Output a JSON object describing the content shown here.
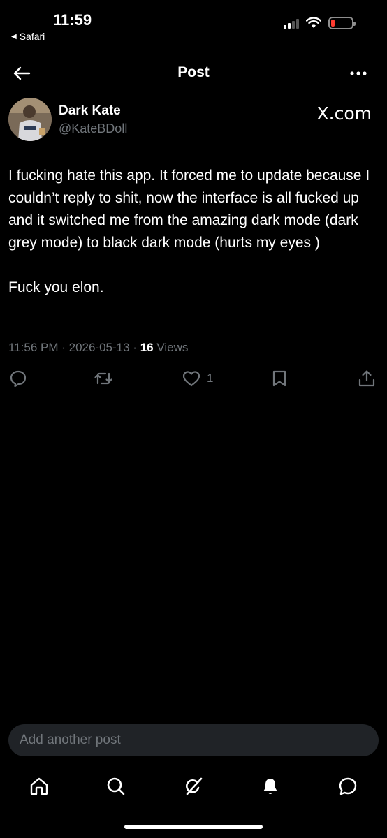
{
  "status_bar": {
    "time": "11:59",
    "back_app": "Safari",
    "battery_color": "#ff3b30"
  },
  "header": {
    "title": "Post",
    "back_icon": "arrow-left-icon",
    "more_icon": "more-horizontal-icon"
  },
  "post": {
    "author_name": "Dark Kate",
    "author_handle": "@KateBDoll",
    "brand": "X.com",
    "paragraphs": [
      "I fucking hate this app. It forced me to update because I couldn’t reply to shit, now the interface is all fucked up and it switched me from the amazing dark mode (dark grey mode) to black dark mode (hurts my eyes )",
      "Fuck you elon."
    ],
    "timestamp": "11:56 PM · 2026-05-13 · ",
    "views_count": "16",
    "views_label": " Views"
  },
  "actions": {
    "reply_icon": "reply-icon",
    "repost_icon": "repost-icon",
    "like_icon": "heart-icon",
    "like_count": "1",
    "bookmark_icon": "bookmark-icon",
    "share_icon": "share-icon"
  },
  "reply": {
    "placeholder": "Add another post"
  },
  "bottom_nav": {
    "items": [
      "home-icon",
      "search-icon",
      "grok-icon",
      "notifications-icon",
      "messages-icon"
    ]
  },
  "colors": {
    "background": "#000000",
    "secondary_text": "#71767b",
    "input_bg": "#202327"
  }
}
